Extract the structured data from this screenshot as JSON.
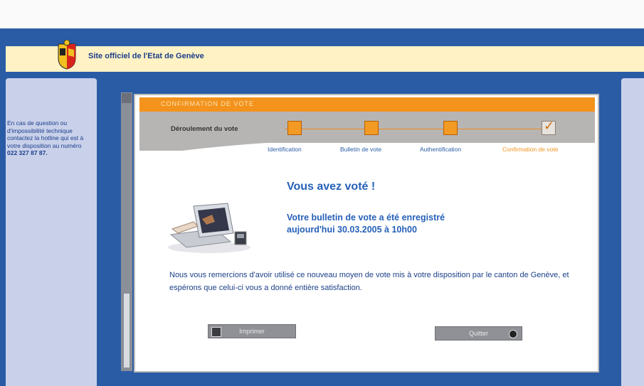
{
  "banner": {
    "title": "Site officiel de l'Etat de Genève"
  },
  "sidebar": {
    "help_text": "En cas de question ou d'impossibilité technique contactez la hotline qui est à votre disposition au numéro",
    "phone": "022 327 87 87."
  },
  "panel": {
    "heading": "CONFIRMATION DE VOTE"
  },
  "progress": {
    "label": "Déroulement du vote",
    "steps": [
      {
        "label": "Identification",
        "status": "done"
      },
      {
        "label": "Bulletin de vote",
        "status": "done"
      },
      {
        "label": "Authentification",
        "status": "done"
      },
      {
        "label": "Confirmation de vote",
        "status": "current"
      }
    ]
  },
  "confirmation": {
    "title": "Vous avez voté !",
    "line1": "Votre bulletin de vote a été enregistré",
    "line2": "aujourd'hui 30.03.2005 à 10h00",
    "thanks": "Nous vous remercions d'avoir utilisé ce nouveau moyen de vote mis à votre disposition par le canton de Genève, et espérons que celui-ci vous a donné entière satisfaction."
  },
  "buttons": {
    "print": "Imprimer",
    "quit": "Quitter"
  },
  "icons": {
    "print": "printer-icon",
    "quit": "exit-icon",
    "check": "check-icon"
  },
  "colors": {
    "frame": "#2a5ca6",
    "accent": "#f3931c",
    "banner": "#fff2c4",
    "text": "#2660b8"
  }
}
